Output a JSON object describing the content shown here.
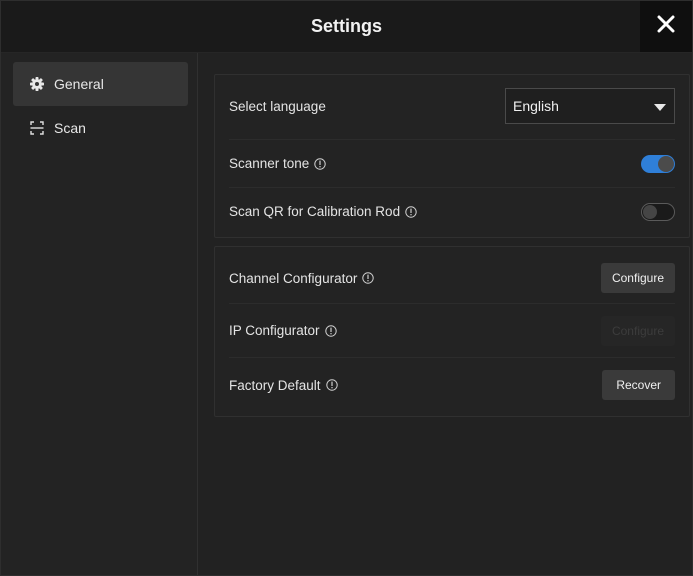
{
  "window": {
    "title": "Settings",
    "close_icon": "close-icon"
  },
  "sidebar": {
    "items": [
      {
        "label": "General",
        "icon": "gear-icon",
        "active": true
      },
      {
        "label": "Scan",
        "icon": "scan-icon",
        "active": false
      }
    ]
  },
  "general": {
    "language": {
      "label": "Select language",
      "value": "English"
    },
    "scanner_tone": {
      "label": "Scanner tone",
      "enabled": true
    },
    "scan_qr": {
      "label": "Scan QR for Calibration Rod",
      "enabled": false
    }
  },
  "config": {
    "channel": {
      "label": "Channel Configurator",
      "button": "Configure",
      "button_enabled": true
    },
    "ip": {
      "label": "IP Configurator",
      "button": "Configure",
      "button_enabled": false
    },
    "factory": {
      "label": "Factory Default",
      "button": "Recover",
      "button_enabled": true
    }
  },
  "colors": {
    "accent": "#2f7fd8",
    "background": "#1c1c1c",
    "panel": "#232323"
  }
}
